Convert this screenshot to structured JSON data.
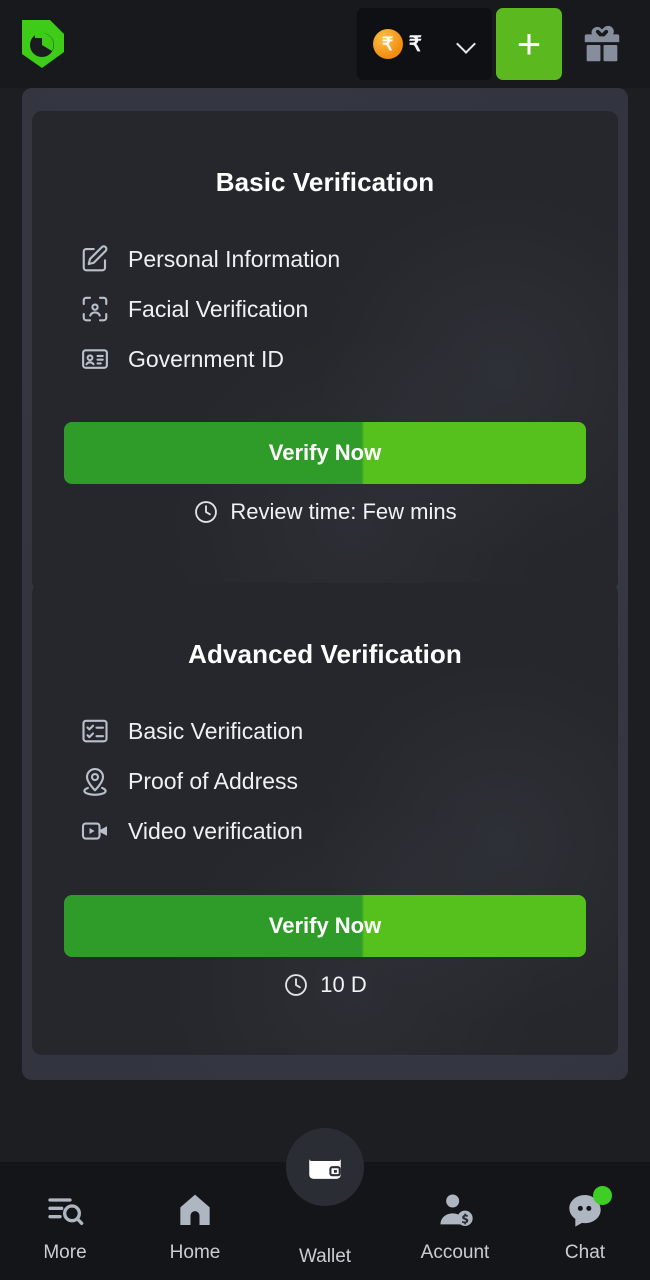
{
  "header": {
    "logo_icon": "brand-logo-icon",
    "currency": {
      "coin_symbol": "₹",
      "code_symbol": "₹",
      "chevron_icon": "chevron-down-icon"
    },
    "add_button_label": "+",
    "gift_icon": "gift-icon"
  },
  "cards": [
    {
      "id": "basic",
      "title": "Basic Verification",
      "features": [
        {
          "icon": "edit-square-icon",
          "label": "Personal Information"
        },
        {
          "icon": "face-scan-icon",
          "label": "Facial Verification"
        },
        {
          "icon": "id-card-icon",
          "label": "Government ID"
        }
      ],
      "cta_label": "Verify Now",
      "meta_icon": "clock-icon",
      "meta_text": "Review time: Few mins"
    },
    {
      "id": "advanced",
      "title": "Advanced Verification",
      "features": [
        {
          "icon": "checklist-icon",
          "label": "Basic Verification"
        },
        {
          "icon": "location-pin-icon",
          "label": "Proof of Address"
        },
        {
          "icon": "video-camera-icon",
          "label": "Video verification"
        }
      ],
      "cta_label": "Verify Now",
      "meta_icon": "clock-icon",
      "meta_text": "10 D"
    }
  ],
  "bottom_nav": {
    "items": [
      {
        "id": "more",
        "label": "More",
        "icon": "list-search-icon"
      },
      {
        "id": "home",
        "label": "Home",
        "icon": "home-icon"
      },
      {
        "id": "wallet",
        "label": "Wallet",
        "icon": "wallet-icon",
        "active": true
      },
      {
        "id": "account",
        "label": "Account",
        "icon": "person-dollar-icon"
      },
      {
        "id": "chat",
        "label": "Chat",
        "icon": "chat-bubble-icon",
        "badge": true
      }
    ]
  },
  "colors": {
    "brand_green": "#5cb81f",
    "button_green_dark": "#2f9c29",
    "button_green_light": "#56c01c",
    "coin_orange": "#f08c10",
    "badge_green": "#3ecf25",
    "card_bg": "#25272c",
    "container_bg": "#32343f",
    "page_bg": "#1c1e22",
    "nav_bg": "#141518"
  }
}
